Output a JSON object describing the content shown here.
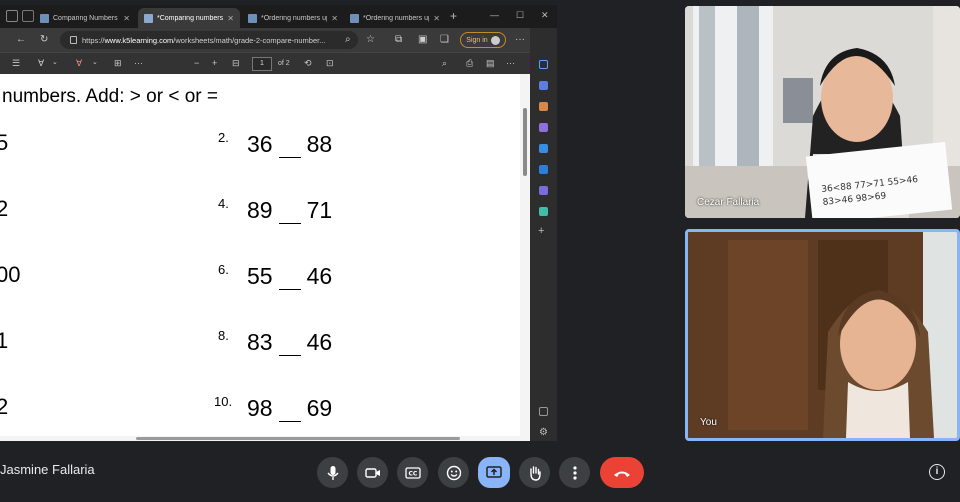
{
  "browser": {
    "tabs": [
      {
        "label": "Comparing Numbers W"
      },
      {
        "label": "*Comparing numbers u"
      },
      {
        "label": "*Ordering numbers up"
      },
      {
        "label": "*Ordering numbers up"
      }
    ],
    "url_prefix": "https://",
    "url_host": "www.k5learning.com",
    "url_path": "/worksheets/math/grade-2-compare-number...",
    "signin_label": "Sign in",
    "page_current": "1",
    "page_total": "of 2"
  },
  "worksheet": {
    "instruction": "numbers. Add: > or < or =",
    "left_fragments": [
      "5",
      "2",
      "00",
      "1",
      "2"
    ],
    "questions": [
      {
        "number": "2.",
        "left": "36",
        "right": "88"
      },
      {
        "number": "4.",
        "left": "89",
        "right": "71"
      },
      {
        "number": "6.",
        "left": "55",
        "right": "46"
      },
      {
        "number": "8.",
        "left": "83",
        "right": "46"
      },
      {
        "number": "10.",
        "left": "98",
        "right": "69"
      }
    ]
  },
  "participants": [
    {
      "name": "Cezar Fallaria"
    },
    {
      "name": "You"
    }
  ],
  "meeting": {
    "self_name": "Jasmine Fallaria"
  },
  "controls": {
    "icons": [
      "microphone-icon",
      "camera-icon",
      "captions-icon",
      "emoji-icon",
      "present-icon",
      "raise-hand-icon",
      "more-icon",
      "end-call-icon",
      "info-icon"
    ],
    "info_glyph": "i"
  },
  "colors": {
    "background": "#202124",
    "present_active": "#8ab4f8",
    "end_call": "#ea4335"
  }
}
